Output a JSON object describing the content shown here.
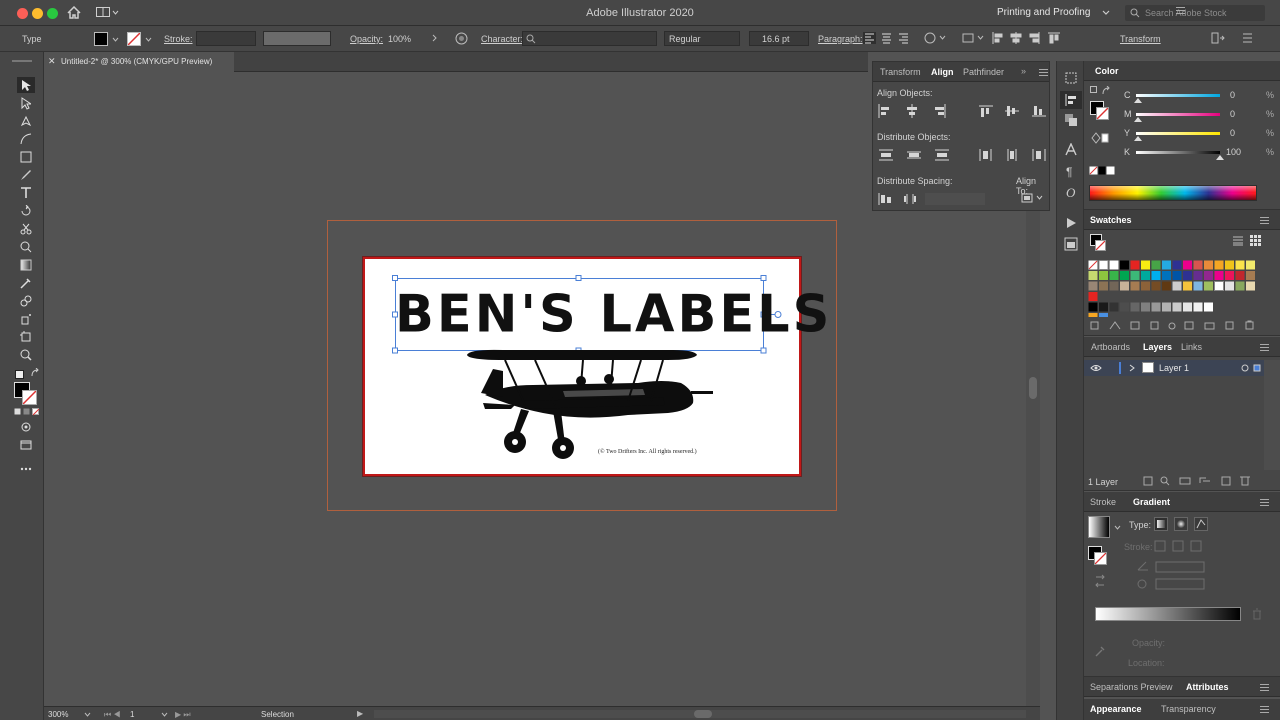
{
  "app": {
    "title": "Adobe Illustrator 2020",
    "workspace": "Printing and Proofing",
    "search_placeholder": "Search Adobe Stock"
  },
  "controlbar": {
    "selection_type": "Type",
    "stroke_label": "Stroke:",
    "opacity_label": "Opacity:",
    "opacity_value": "100%",
    "character_label": "Character:",
    "font_style": "Regular",
    "font_size": "16.6 pt",
    "paragraph_label": "Paragraph:",
    "transform_label": "Transform"
  },
  "document": {
    "tab_title": "Untitled-2* @ 300% (CMYK/GPU Preview)",
    "label_text": "BEN'S LABELS",
    "copyright": "(© Two Drifters Inc.  All rights reserved.)"
  },
  "statusbar": {
    "zoom": "300%",
    "artboard": "1",
    "tool": "Selection"
  },
  "align_panel": {
    "tabs": [
      "Transform",
      "Align",
      "Pathfinder"
    ],
    "align_objects": "Align Objects:",
    "distribute_objects": "Distribute Objects:",
    "distribute_spacing": "Distribute Spacing:",
    "align_to": "Align To:"
  },
  "color_panel": {
    "title": "Color",
    "channels": [
      {
        "label": "C",
        "value": "0"
      },
      {
        "label": "M",
        "value": "0"
      },
      {
        "label": "Y",
        "value": "0"
      },
      {
        "label": "K",
        "value": "100"
      }
    ]
  },
  "swatches_panel": {
    "title": "Swatches"
  },
  "layers_panel": {
    "tabs": [
      "Artboards",
      "Layers",
      "Links"
    ],
    "layer_name": "Layer 1",
    "count": "1 Layer"
  },
  "gradient_panel": {
    "tabs": [
      "Stroke",
      "Gradient"
    ],
    "type_label": "Type:",
    "stroke_label": "Stroke:",
    "opacity_label": "Opacity:",
    "location_label": "Location:"
  },
  "bottom_tabs": {
    "row1": [
      "Separations Preview",
      "Attributes"
    ],
    "row2": [
      "Appearance",
      "Transparency"
    ]
  },
  "colors": {
    "artboard_border": "#c01818",
    "bleed": "#c0644a",
    "selection": "#4a7fd6"
  }
}
